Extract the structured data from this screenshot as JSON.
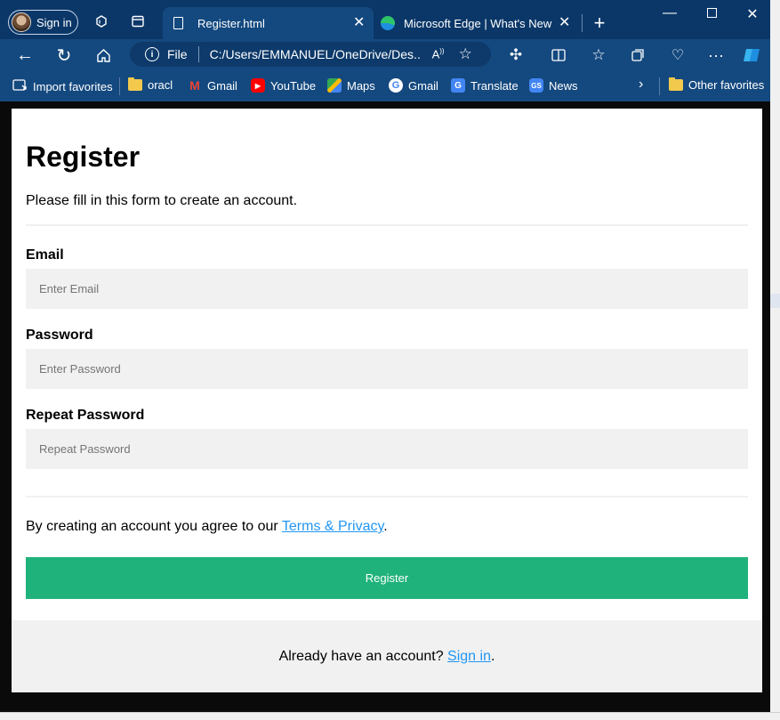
{
  "browser": {
    "profile_label": "Sign in",
    "tabs": [
      {
        "label": "Register.html",
        "active": true
      },
      {
        "label": "Microsoft Edge | What's New",
        "active": false
      }
    ],
    "address": {
      "scheme_label": "File",
      "url": "C:/Users/EMMANUEL/OneDrive/Des..."
    },
    "favorites": [
      {
        "label": "Import favorites",
        "icon": "import-icon"
      },
      {
        "label": "oracl",
        "icon": "folder-icon"
      },
      {
        "label": "Gmail",
        "icon": "gmail-icon"
      },
      {
        "label": "YouTube",
        "icon": "youtube-icon"
      },
      {
        "label": "Maps",
        "icon": "maps-icon"
      },
      {
        "label": "Gmail",
        "icon": "google-icon"
      },
      {
        "label": "Translate",
        "icon": "translate-icon"
      },
      {
        "label": "News",
        "icon": "news-icon"
      }
    ],
    "other_favorites": "Other favorites"
  },
  "form": {
    "title": "Register",
    "subtitle": "Please fill in this form to create an account.",
    "email": {
      "label": "Email",
      "placeholder": "Enter Email",
      "value": ""
    },
    "password": {
      "label": "Password",
      "placeholder": "Enter Password",
      "value": ""
    },
    "repeat_password": {
      "label": "Repeat Password",
      "placeholder": "Repeat Password",
      "value": ""
    },
    "terms_prefix": "By creating an account you agree to our ",
    "terms_link": "Terms & Privacy",
    "terms_suffix": ".",
    "submit_label": "Register",
    "signin_prefix": "Already have an account? ",
    "signin_link": "Sign in",
    "signin_suffix": "."
  },
  "colors": {
    "chrome": "#0b3768",
    "toolbar": "#14497f",
    "accent_button": "#1fb27a",
    "link": "#2196f3",
    "input_bg": "#f1f1f1"
  }
}
